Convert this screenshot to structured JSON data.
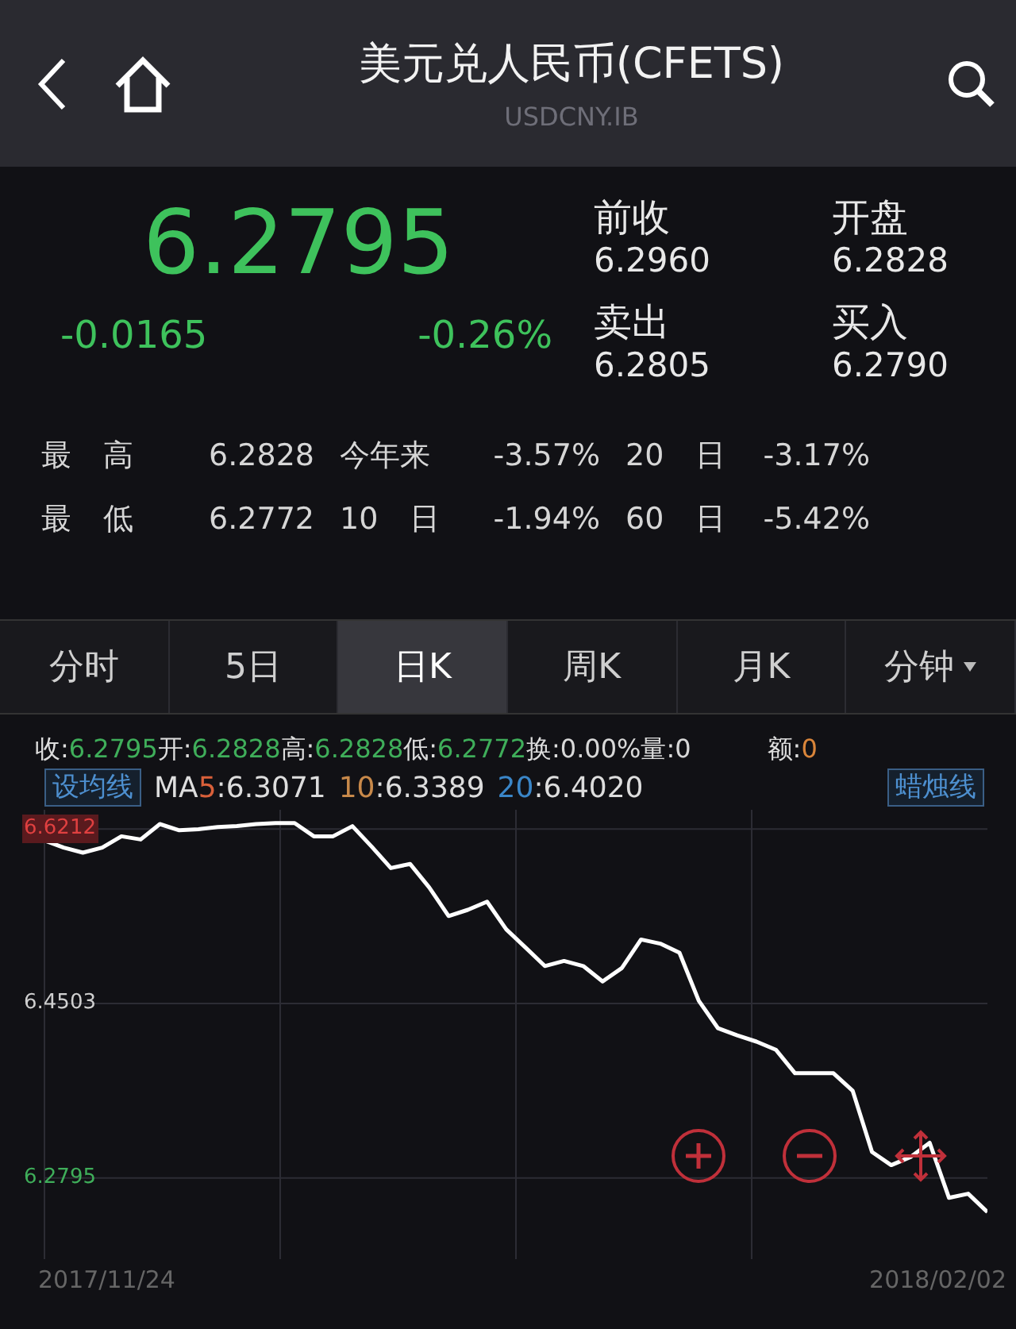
{
  "header": {
    "title": "美元兑人民币(CFETS)",
    "subtitle": "USDCNY.IB"
  },
  "quote": {
    "price": "6.2795",
    "change": "-0.0165",
    "change_pct": "-0.26%",
    "fields": [
      {
        "label": "前收",
        "value": "6.2960"
      },
      {
        "label": "开盘",
        "value": "6.2828"
      },
      {
        "label": "卖出",
        "value": "6.2805"
      },
      {
        "label": "买入",
        "value": "6.2790"
      }
    ]
  },
  "stats": [
    [
      {
        "label": "最 高",
        "value": "6.2828"
      },
      {
        "label": "今年来",
        "value": "-3.57%"
      },
      {
        "label": "20 日",
        "value": "-3.17%"
      }
    ],
    [
      {
        "label": "最 低",
        "value": "6.2772"
      },
      {
        "label": "10 日",
        "value": "-1.94%"
      },
      {
        "label": "60 日",
        "value": "-5.42%"
      }
    ]
  ],
  "tabs": [
    {
      "label": "分时",
      "selected": false,
      "dropdown": false
    },
    {
      "label": "5日",
      "selected": false,
      "dropdown": false
    },
    {
      "label": "日K",
      "selected": true,
      "dropdown": false
    },
    {
      "label": "周K",
      "selected": false,
      "dropdown": false
    },
    {
      "label": "月K",
      "selected": false,
      "dropdown": false
    },
    {
      "label": "分钟",
      "selected": false,
      "dropdown": true
    }
  ],
  "info": [
    {
      "label": "收:",
      "value": "6.2795",
      "color": "#3fae5a"
    },
    {
      "label": "开:",
      "value": "6.2828",
      "color": "#3fae5a"
    },
    {
      "label": "高:",
      "value": "6.2828",
      "color": "#3fae5a"
    },
    {
      "label": "低:",
      "value": "6.2772",
      "color": "#3fae5a"
    },
    {
      "label": "换:",
      "value": "0.00%",
      "color": "#d8d8d8"
    },
    {
      "label": "量:",
      "value": "0",
      "color": "#d8d8d8"
    },
    {
      "label": "额:",
      "value": "0",
      "color": "#d9853a"
    }
  ],
  "ma_button": "设均线",
  "ma_prefix": "MA",
  "ma": [
    {
      "period": "5",
      "value": ":6.3071",
      "color": "#d9603a"
    },
    {
      "period": "10",
      "value": ":6.3389",
      "color": "#c8894a"
    },
    {
      "period": "20",
      "value": ":6.4020",
      "color": "#3a86c8"
    }
  ],
  "style_button": "蜡烛线",
  "dates": [
    "2017/11/24",
    "2018/02/02"
  ],
  "chart_data": {
    "type": "line",
    "ylim": [
      6.2,
      6.64
    ],
    "grid": true,
    "yticks": [
      {
        "value": 6.6212,
        "label": "6.6212"
      },
      {
        "value": 6.4503,
        "label": "6.4503"
      },
      {
        "value": 6.2795,
        "label": "6.2795"
      }
    ],
    "series": [
      {
        "color": "#ffffff",
        "values": [
          6.61,
          6.603,
          6.598,
          6.603,
          6.614,
          6.611,
          6.626,
          6.62,
          6.621,
          6.623,
          6.624,
          6.626,
          6.627,
          6.627,
          6.614,
          6.614,
          6.624,
          6.604,
          6.583,
          6.587,
          6.564,
          6.536,
          6.542,
          6.55,
          6.523,
          6.505,
          6.487,
          6.492,
          6.487,
          6.472,
          6.485,
          6.513,
          6.509,
          6.5,
          6.453,
          6.426,
          6.419,
          6.413,
          6.405,
          6.382,
          6.382,
          6.382,
          6.365,
          6.305,
          6.292,
          6.3,
          6.314,
          6.26,
          6.264,
          6.246
        ]
      }
    ]
  }
}
